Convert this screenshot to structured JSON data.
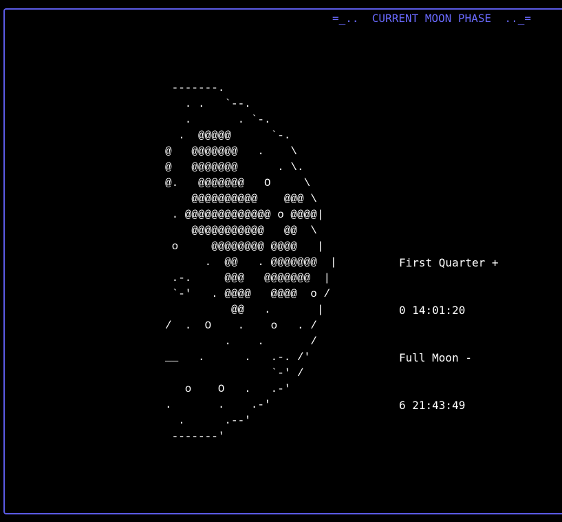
{
  "panel": {
    "title": "=_..  CURRENT MOON PHASE  .._=",
    "border_color": "#5b5be6",
    "title_color": "#6a6aff"
  },
  "moon": {
    "art": " -------.\n   . .   `--.\n   .       . `-.\n  .  @@@@@      `-.\n@   @@@@@@@   .    \\\n@   @@@@@@@      . \\.\n@.   @@@@@@@   O     \\\n    @@@@@@@@@@    @@@ \\\n . @@@@@@@@@@@@@ o @@@@|\n    @@@@@@@@@@@   @@  \\\n o     @@@@@@@@ @@@@   |\n      .  @@   . @@@@@@@  |\n .-.     @@@   @@@@@@@  |\n `-'   . @@@@   @@@@  o /\n          @@   .       |\n/  .  O    .    o   . /\n         .    .       /\n__   .      .   .-. /'\n                `-' /\n   o    O   .   .-'\n.       .    .-'\n  .      .--'\n -------'"
  },
  "phase_info": {
    "line1": "First Quarter +",
    "line2": "0 14:01:20",
    "line3": "Full Moon -",
    "line4": "6 21:43:49"
  }
}
